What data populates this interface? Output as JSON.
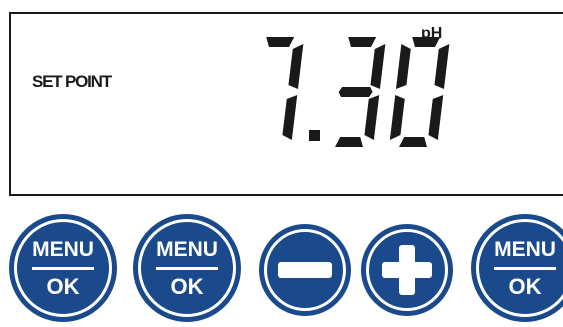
{
  "display": {
    "mode_label": "SET POINT",
    "value": "7.30",
    "unit": "pH"
  },
  "buttons": [
    {
      "top": "MENU",
      "bottom": "OK"
    },
    {
      "top": "MENU",
      "bottom": "OK"
    },
    {
      "icon": "minus-icon"
    },
    {
      "icon": "plus-icon"
    },
    {
      "top": "MENU",
      "bottom": "OK"
    }
  ],
  "colors": {
    "button_blue": "#1b4a8c",
    "lcd_text": "#1a1a1a",
    "background": "#ffffff"
  }
}
